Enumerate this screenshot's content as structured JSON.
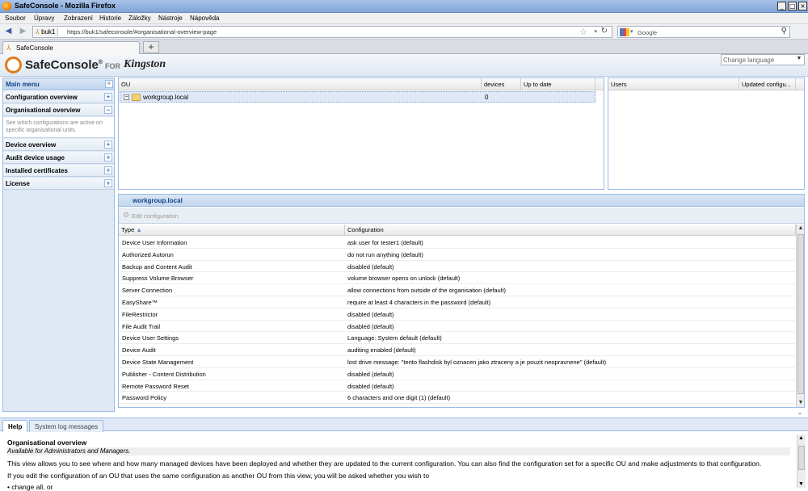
{
  "window": {
    "title": "SafeConsole - Mozilla Firefox",
    "min": "_",
    "max": "□",
    "close": "×"
  },
  "menu": [
    "Soubor",
    "Úpravy",
    "Zobrazení",
    "Historie",
    "Záložky",
    "Nástroje",
    "Nápověda"
  ],
  "nav": {
    "identity": "buk1",
    "url": "https://buk1/safeconsole/#organisational-overview-page",
    "search_placeholder": "Google"
  },
  "tab": {
    "label": "SafeConsole",
    "new_tab": "+"
  },
  "app": {
    "logo_name": "SafeConsole",
    "logo_reg": "®",
    "logo_for": "FOR",
    "logo_brand": "Kingston",
    "language_placeholder": "Change language"
  },
  "sidebar": {
    "title": "Main menu",
    "items": [
      {
        "label": "Configuration overview",
        "toggle": "+"
      },
      {
        "label": "Organisational overview",
        "toggle": "−"
      },
      {
        "label": "Device overview",
        "toggle": "+"
      },
      {
        "label": "Audit device usage",
        "toggle": "+"
      },
      {
        "label": "Installed certificates",
        "toggle": "+"
      },
      {
        "label": "License",
        "toggle": "+"
      }
    ],
    "description": "See which configurations are active on specific organisational units."
  },
  "ou_grid": {
    "columns": [
      "OU",
      "devices",
      "Up to date"
    ],
    "rows": [
      {
        "name": "workgroup.local",
        "devices": "0",
        "up_to_date": ""
      }
    ]
  },
  "users_grid": {
    "columns": [
      "Users",
      "Updated configu..."
    ]
  },
  "config_panel": {
    "title": "workgroup.local",
    "edit_button": "Edit configuration",
    "columns": [
      "Type",
      "Configuration"
    ],
    "rows": [
      {
        "type": "Device User Information",
        "config": "ask user for tester1 (default)"
      },
      {
        "type": "Authorized Autorun",
        "config": "do not run anything (default)"
      },
      {
        "type": "Backup and Content Audit",
        "config": "disabled (default)"
      },
      {
        "type": "Suppress Volume Browser",
        "config": "volume browser opens on unlock (default)"
      },
      {
        "type": "Server Connection",
        "config": "allow connections from outside of the organisation (default)"
      },
      {
        "type": "EasyShare™",
        "config": "require at least 4 characters in the password (default)"
      },
      {
        "type": "FileRestrictor",
        "config": "disabled (default)"
      },
      {
        "type": "File Audit Trail",
        "config": "disabled (default)"
      },
      {
        "type": "Device User Settings",
        "config": "Language: System default (default)"
      },
      {
        "type": "Device Audit",
        "config": "auditing enabled (default)"
      },
      {
        "type": "Device State Management",
        "config": "lost drive message: \"tento flashdisk byl oznacen jako ztraceny a je pouzit neopravnene\" (default)"
      },
      {
        "type": "Publisher - Content Distribution",
        "config": "disabled (default)"
      },
      {
        "type": "Remote Password Reset",
        "config": "disabled (default)"
      },
      {
        "type": "Password Policy",
        "config": "6 characters and one digit (1) (default)"
      }
    ]
  },
  "bottom": {
    "tabs": [
      "Help",
      "System log messages"
    ],
    "help_title": "Organisational overview",
    "help_subtitle": "Available for Administrators and Managers.",
    "help_p1": "This view allows you to see where and how many managed devices have been deployed and whether they are updated to the current configuration. You can also find the configuration set for a specific OU and make adjustments to that configuration.",
    "help_p2": "If you edit the configuration of an OU that uses the same configuration as another OU from this view, you will be asked whether you wish to",
    "help_bullet": "• change all, or"
  }
}
